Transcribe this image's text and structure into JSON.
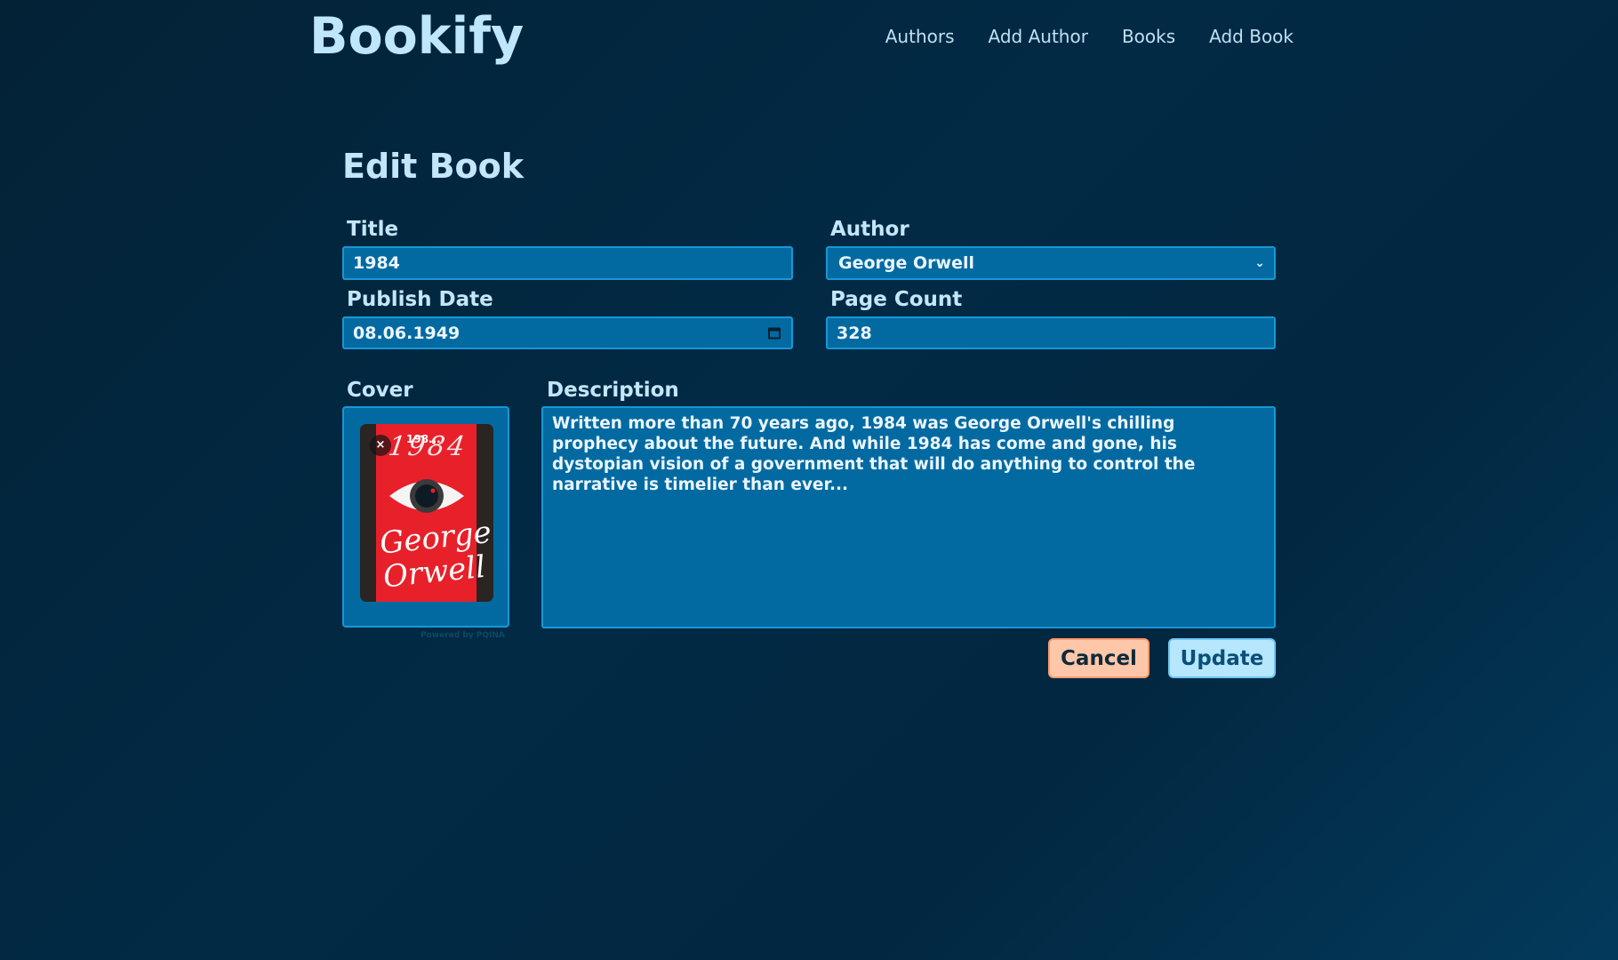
{
  "app": {
    "brand": "Bookify"
  },
  "nav": {
    "items": [
      "Authors",
      "Add Author",
      "Books",
      "Add Book"
    ]
  },
  "page": {
    "title": "Edit Book"
  },
  "form": {
    "title": {
      "label": "Title",
      "value": "1984"
    },
    "author": {
      "label": "Author",
      "selected": "George Orwell"
    },
    "publish_date": {
      "label": "Publish Date",
      "value": "08.06.1949"
    },
    "page_count": {
      "label": "Page Count",
      "value": "328"
    },
    "cover": {
      "label": "Cover",
      "filename": "198...",
      "remove_icon": "×",
      "image_title_text": "1984",
      "image_author_line1": "George",
      "image_author_line2": "Orwell",
      "powered_by": "Powered by PQINA"
    },
    "description": {
      "label": "Description",
      "value": "Written more than 70 years ago, 1984 was George Orwell's chilling prophecy about the future. And while 1984 has come and gone, his dystopian vision of a government that will do anything to control the narrative is timelier than ever..."
    }
  },
  "actions": {
    "cancel_label": "Cancel",
    "update_label": "Update"
  },
  "colors": {
    "background": "#022a45",
    "input_bg": "#036aa1",
    "input_border": "#1698d6",
    "cancel_bg": "#ffc7a9",
    "update_bg": "#b7e6ff",
    "cover_red": "#e8202a"
  }
}
